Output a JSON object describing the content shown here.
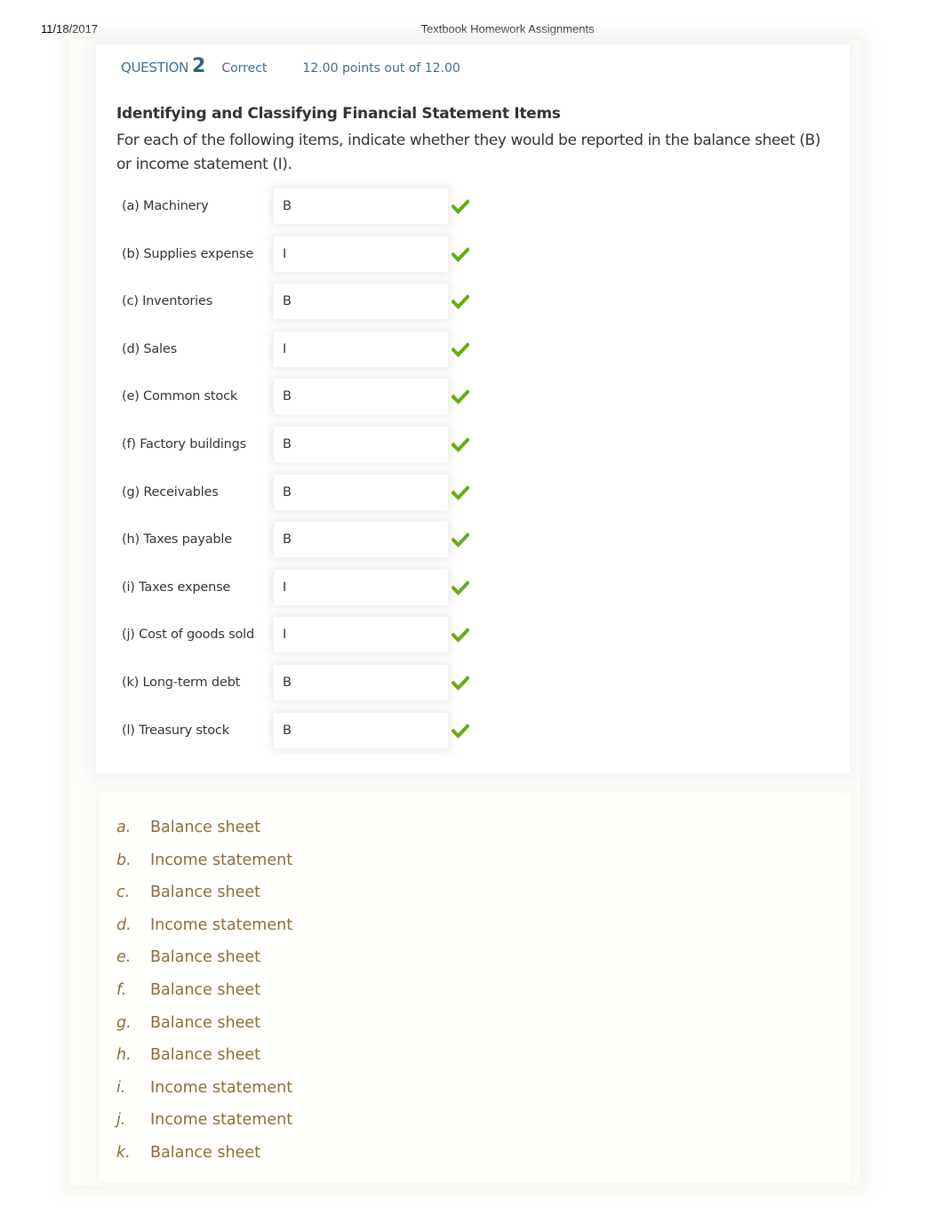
{
  "print_header": {
    "date": "11/18/2017",
    "title": "Textbook Homework Assignments"
  },
  "question": {
    "label": "QUESTION",
    "number": "2",
    "status": "Correct",
    "points": "12.00 points out of 12.00",
    "title": "Identifying and Classifying Financial Statement Items",
    "prompt": "For each of the following items, indicate whether they would be reported in the balance sheet (B) or income statement (I).",
    "accent_color": "#3b6e8f",
    "check_color": "#6aab12"
  },
  "items": [
    {
      "label": "(a) Machinery",
      "answer": "B",
      "result": "correct"
    },
    {
      "label": "(b) Supplies expense",
      "answer": "I",
      "result": "correct"
    },
    {
      "label": "(c) Inventories",
      "answer": "B",
      "result": "correct"
    },
    {
      "label": "(d) Sales",
      "answer": "I",
      "result": "correct"
    },
    {
      "label": "(e) Common stock",
      "answer": "B",
      "result": "correct"
    },
    {
      "label": "(f) Factory buildings",
      "answer": "B",
      "result": "correct"
    },
    {
      "label": "(g) Receivables",
      "answer": "B",
      "result": "correct"
    },
    {
      "label": "(h) Taxes payable",
      "answer": "B",
      "result": "correct"
    },
    {
      "label": "(i) Taxes expense",
      "answer": "I",
      "result": "correct"
    },
    {
      "label": "(j) Cost of goods sold",
      "answer": "I",
      "result": "correct"
    },
    {
      "label": "(k) Long-term debt",
      "answer": "B",
      "result": "correct"
    },
    {
      "label": "(l) Treasury stock",
      "answer": "B",
      "result": "correct"
    }
  ],
  "solution": {
    "text_color": "#8a6d3b",
    "rows": [
      {
        "letter": "a.",
        "text": "Balance sheet"
      },
      {
        "letter": "b.",
        "text": "Income statement"
      },
      {
        "letter": "c.",
        "text": "Balance sheet"
      },
      {
        "letter": "d.",
        "text": "Income statement"
      },
      {
        "letter": "e.",
        "text": "Balance sheet"
      },
      {
        "letter": "f.",
        "text": "Balance sheet"
      },
      {
        "letter": "g.",
        "text": "Balance sheet"
      },
      {
        "letter": "h.",
        "text": "Balance sheet"
      },
      {
        "letter": "i.",
        "text": "Income statement"
      },
      {
        "letter": "j.",
        "text": "Income statement"
      },
      {
        "letter": "k.",
        "text": "Balance sheet"
      }
    ]
  }
}
